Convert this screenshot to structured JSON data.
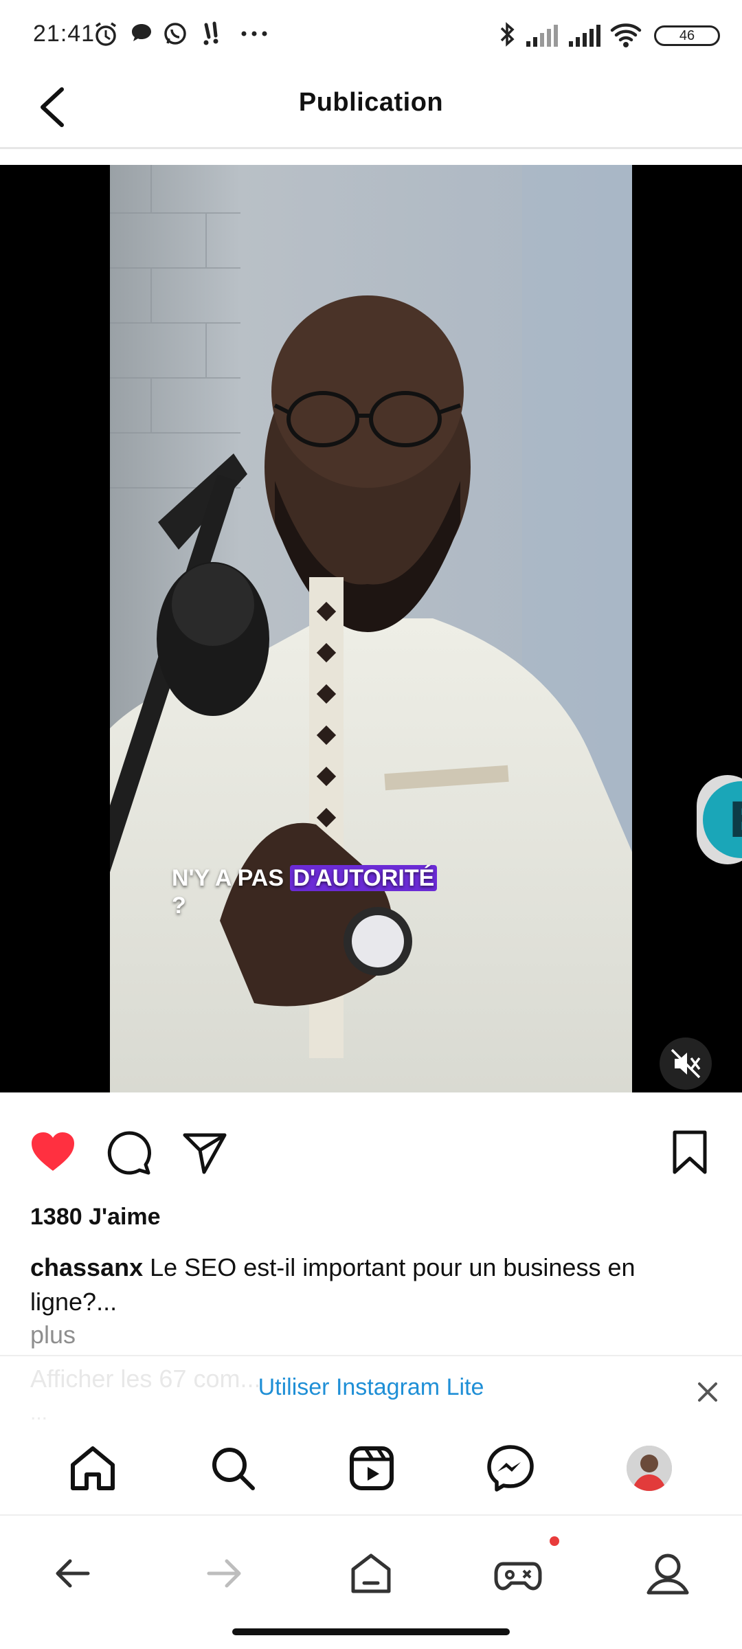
{
  "status_bar": {
    "time": "21:41",
    "battery": "46",
    "icons": [
      "alarm-icon",
      "chat-bubble-icon",
      "whatsapp-icon",
      "notification-icon",
      "more-dots-icon",
      "bluetooth-icon",
      "signal-icon",
      "signal-icon",
      "wifi-icon",
      "battery-icon"
    ]
  },
  "header": {
    "title": "Publication",
    "back_icon": "chevron-left-icon"
  },
  "media": {
    "caption_line1_part1": "N'Y A PAS ",
    "caption_line1_highlight": "D'AUTORITÉ",
    "caption_line2": "?",
    "mute_icon": "volume-muted-icon",
    "floating_badge_letter": "E"
  },
  "actions": {
    "icons": [
      "heart-filled-icon",
      "comment-icon",
      "share-send-icon",
      "bookmark-icon"
    ],
    "like_color": "#ff3040"
  },
  "post": {
    "likes": "1380 J'aime",
    "username": "chassanx",
    "caption": "Le SEO est-il important pour un business en ligne?...",
    "more": "plus",
    "comments_hint": "Afficher les 67 com...",
    "time_hint": "... "
  },
  "banner": {
    "cta": "Utiliser Instagram Lite",
    "close_icon": "close-icon",
    "cta_color": "#1f8fd6"
  },
  "ig_tabs": [
    "home-icon",
    "search-icon",
    "reels-icon",
    "messenger-icon",
    "profile-avatar"
  ],
  "browser_bar": [
    "back-arrow-icon",
    "forward-arrow-icon",
    "home-tab-icon",
    "games-icon",
    "account-icon"
  ]
}
